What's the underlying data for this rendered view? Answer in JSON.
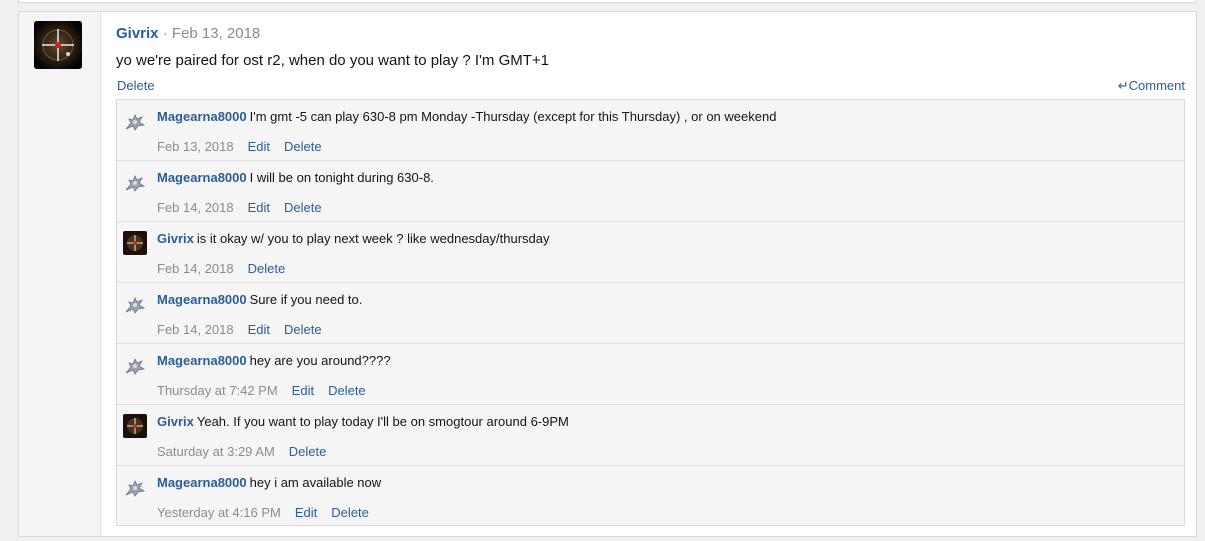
{
  "post": {
    "username": "Givrix",
    "separator": "·",
    "date": "Feb 13, 2018",
    "body": "yo we're paired for ost r2, when do you want to play ? I'm GMT+1",
    "delete_label": "Delete",
    "comment_label": "Comment",
    "comment_icon": "reply-icon"
  },
  "comments": [
    {
      "user": "Magearna8000",
      "text": "I'm gmt -5 can play 630-8 pm Monday -Thursday (except for this Thursday) , or on weekend",
      "date": "Feb 13, 2018",
      "actions": [
        "Edit",
        "Delete"
      ],
      "avatar": "magearna"
    },
    {
      "user": "Magearna8000",
      "text": "I will be on tonight during 630-8.",
      "date": "Feb 14, 2018",
      "actions": [
        "Edit",
        "Delete"
      ],
      "avatar": "magearna"
    },
    {
      "user": "Givrix",
      "text": "is it okay w/ you to play next week ? like wednesday/thursday",
      "date": "Feb 14, 2018",
      "actions": [
        "Delete"
      ],
      "avatar": "givrix"
    },
    {
      "user": "Magearna8000",
      "text": "Sure if you need to.",
      "date": "Feb 14, 2018",
      "actions": [
        "Edit",
        "Delete"
      ],
      "avatar": "magearna"
    },
    {
      "user": "Magearna8000",
      "text": "hey are you around????",
      "date": "Thursday at 7:42 PM",
      "actions": [
        "Edit",
        "Delete"
      ],
      "avatar": "magearna"
    },
    {
      "user": "Givrix",
      "text": "Yeah. If you want to play today I'll be on smogtour around 6-9PM",
      "date": "Saturday at 3:29 AM",
      "actions": [
        "Delete"
      ],
      "avatar": "givrix"
    },
    {
      "user": "Magearna8000",
      "text": "hey i am available now",
      "date": "Yesterday at 4:16 PM",
      "actions": [
        "Edit",
        "Delete"
      ],
      "avatar": "magearna"
    }
  ],
  "colors": {
    "link": "#2b5d9a",
    "muted": "#8c8c8c",
    "panel": "#f5f5f5",
    "border": "#dadada"
  }
}
